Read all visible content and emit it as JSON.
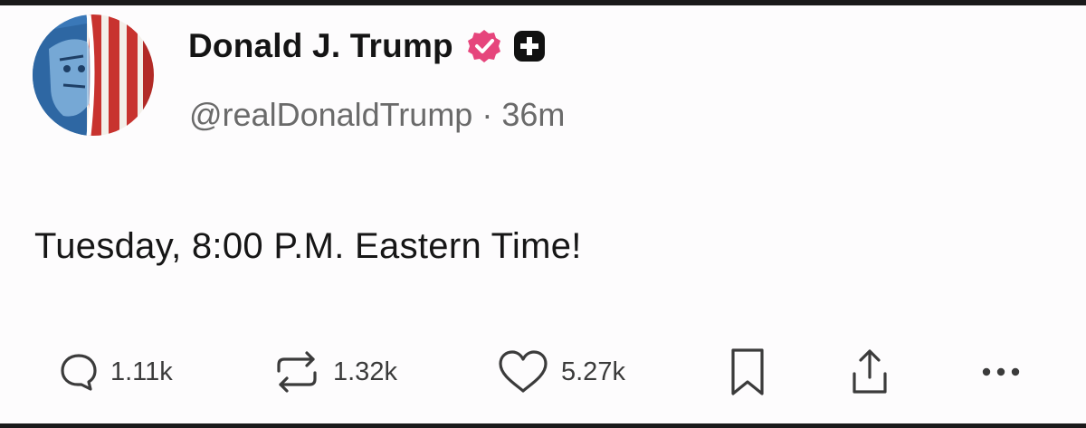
{
  "post": {
    "author": {
      "display_name": "Donald J. Trump",
      "handle": "@realDonaldTrump",
      "separator": "·",
      "time_ago": "36m",
      "verified_color": "#e6457c",
      "plus_badge_color": "#111111"
    },
    "text": "Tuesday, 8:00 P.M. Eastern Time!",
    "actions": {
      "reply_count": "1.11k",
      "repost_count": "1.32k",
      "like_count": "5.27k"
    }
  },
  "icons": [
    "reply-icon",
    "repost-icon",
    "heart-icon",
    "bookmark-icon",
    "share-icon",
    "more-icon",
    "verified-icon",
    "plus-icon"
  ]
}
